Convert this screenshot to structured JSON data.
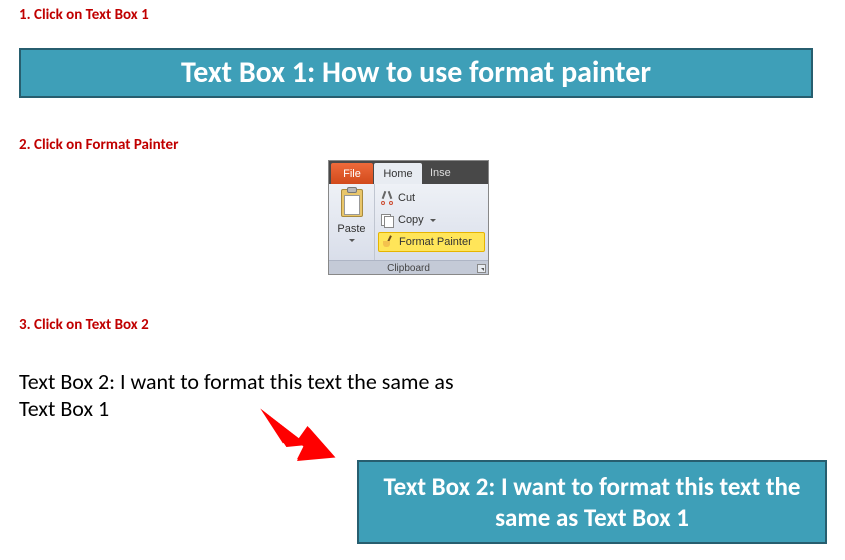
{
  "steps": {
    "s1": "1. Click on Text Box 1",
    "s2": "2. Click on Format Painter",
    "s3": "3. Click on Text Box 2"
  },
  "textbox1": "Text Box 1: How to use format painter",
  "ribbon": {
    "tabs": {
      "file": "File",
      "home": "Home",
      "insert": "Inse"
    },
    "paste": "Paste",
    "cut": "Cut",
    "copy": "Copy",
    "format_painter": "Format Painter",
    "group": "Clipboard"
  },
  "textbox2_plain": "Text Box 2: I want to format this text the same as Text Box 1",
  "textbox2_formatted": "Text Box 2: I want to format this text the same as Text Box 1"
}
